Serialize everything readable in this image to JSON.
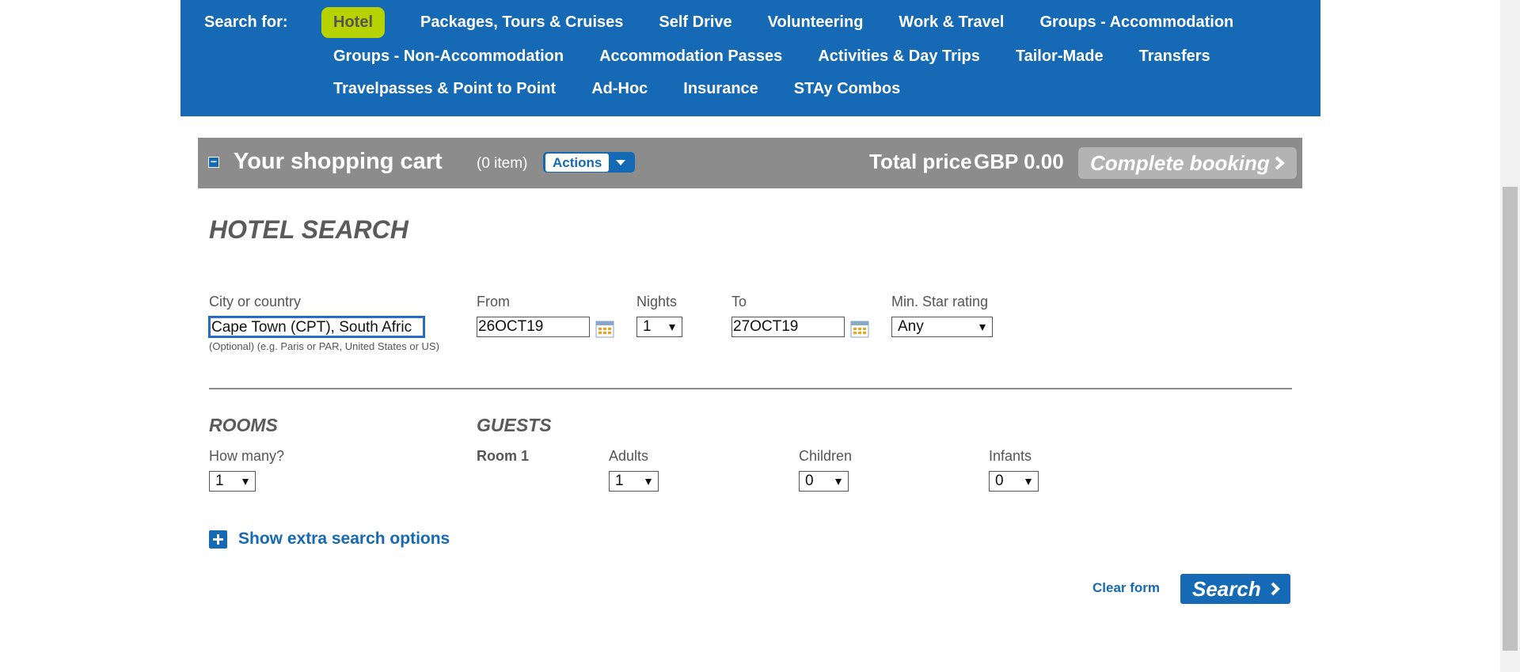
{
  "nav": {
    "search_for_label": "Search for:",
    "row1": [
      "Hotel",
      "Packages, Tours & Cruises",
      "Self Drive",
      "Volunteering",
      "Work & Travel",
      "Groups - Accommodation"
    ],
    "row2": [
      "Groups - Non-Accommodation",
      "Accommodation Passes",
      "Activities & Day Trips",
      "Tailor-Made",
      "Transfers"
    ],
    "row3": [
      "Travelpasses & Point to Point",
      "Ad-Hoc",
      "Insurance",
      "STAy Combos"
    ],
    "active": "Hotel",
    "colors": {
      "nav_bg": "#1669b4",
      "active_bg": "#b6d300"
    }
  },
  "cart": {
    "collapse_symbol": "−",
    "title": "Your shopping cart",
    "count": "(0 item)",
    "actions_label": "Actions",
    "total_label": "Total price",
    "total_value": "GBP 0.00",
    "complete_label": "Complete booking",
    "colors": {
      "bar_bg": "#8c8c8c",
      "complete_bg": "#b3b3b3"
    }
  },
  "form": {
    "heading": "HOTEL SEARCH",
    "city_label": "City or country",
    "city_value": "Cape Town (CPT), South Afric",
    "city_hint": "(Optional) (e.g. Paris or PAR, United States or US)",
    "from_label": "From",
    "from_value": "26OCT19",
    "nights_label": "Nights",
    "nights_value": "1",
    "to_label": "To",
    "to_value": "27OCT19",
    "star_label": "Min. Star rating",
    "star_value": "Any",
    "rooms_heading": "ROOMS",
    "rooms_label": "How many?",
    "rooms_value": "1",
    "guests_heading": "GUESTS",
    "room1_label": "Room 1",
    "adults_label": "Adults",
    "adults_value": "1",
    "children_label": "Children",
    "children_value": "0",
    "infants_label": "Infants",
    "infants_value": "0",
    "extra_options_label": "Show extra search options",
    "clear_label": "Clear form",
    "search_label": "Search"
  },
  "icons": {
    "calendar": "calendar-icon",
    "plus": "plus-icon",
    "chevron": "chevron-right-icon",
    "caret": "chevron-down-icon"
  }
}
